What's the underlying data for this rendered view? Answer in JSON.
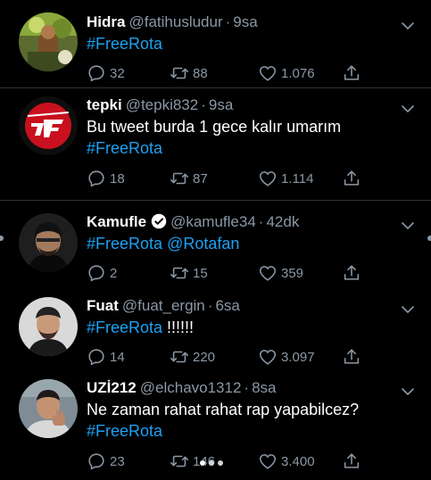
{
  "colors": {
    "background": "#000000",
    "link": "#1da1f2",
    "muted": "#8b98a5",
    "divider": "#2f3336"
  },
  "tweets": [
    {
      "name": "Hidra",
      "handle": "@fatihusludur",
      "time": "9sa",
      "lines": [
        [
          {
            "t": "#FreeRota",
            "c": "tag"
          }
        ]
      ],
      "reply": "32",
      "retweet": "88",
      "like": "1.076"
    },
    {
      "name": "tepki",
      "handle": "@tepki832",
      "time": "9sa",
      "lines": [
        [
          {
            "t": "Bu tweet burda 1 gece kalır umarım",
            "c": ""
          }
        ],
        [
          {
            "t": "#FreeRota",
            "c": "tag"
          }
        ]
      ],
      "reply": "18",
      "retweet": "87",
      "like": "1.114"
    },
    {
      "name": "Kamufle",
      "handle": "@kamufle34",
      "time": "42dk",
      "verified": true,
      "lines": [
        [
          {
            "t": "#FreeRota",
            "c": "tag"
          },
          {
            "t": " ",
            "c": ""
          },
          {
            "t": "@Rotafan",
            "c": "tag"
          }
        ]
      ],
      "reply": "2",
      "retweet": "15",
      "like": "359"
    },
    {
      "name": "Fuat",
      "handle": "@fuat_ergin",
      "time": "6sa",
      "lines": [
        [
          {
            "t": "#FreeRota",
            "c": "tag"
          },
          {
            "t": " !!!!!!",
            "c": ""
          }
        ]
      ],
      "reply": "14",
      "retweet": "220",
      "like": "3.097"
    },
    {
      "name": "UZİ212",
      "handle": "@elchavo1312",
      "time": "8sa",
      "lines": [
        [
          {
            "t": "Ne zaman rahat rahat rap yapabilcez?",
            "c": ""
          }
        ],
        [
          {
            "t": "#FreeRota",
            "c": "tag"
          }
        ]
      ],
      "reply": "23",
      "retweet": "146",
      "like": "3.400"
    }
  ],
  "icons": {
    "reply": "reply-icon",
    "retweet": "retweet-icon",
    "like": "heart-icon",
    "share": "share-icon",
    "menu": "chevron-down-icon",
    "verified": "verified-badge-icon"
  }
}
